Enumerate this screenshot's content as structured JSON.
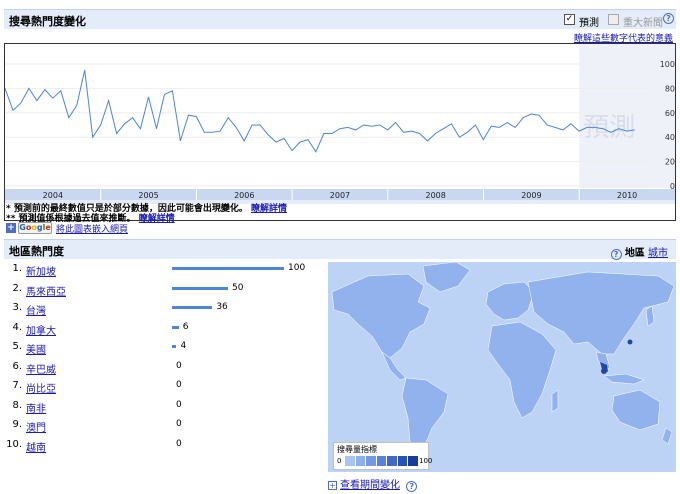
{
  "top_section": {
    "title": "搜尋熱門度變化",
    "forecast_label": "預測",
    "forecast_checked": true,
    "news_label": "重大新聞",
    "news_checked": false,
    "help": "?",
    "learn_link": "瞭解這些數字代表的意義"
  },
  "chart_data": {
    "type": "line",
    "title": "",
    "xlabel": "",
    "ylabel": "",
    "ylim": [
      0,
      100
    ],
    "yticks": [
      "100",
      "80",
      "60",
      "40",
      "20",
      "0"
    ],
    "year_labels": [
      "2004",
      "2005",
      "2006",
      "2007",
      "2008",
      "2009",
      "2010"
    ],
    "x_start": 2004.0,
    "forecast_start": 2010.0,
    "forecast_watermark": "預測",
    "series": [
      {
        "x_step": 0.0833,
        "values": [
          80,
          62,
          68,
          80,
          70,
          79,
          72,
          78,
          56,
          66,
          95,
          40,
          50,
          70,
          43,
          51,
          56,
          47,
          73,
          47,
          75,
          78,
          37,
          58,
          57,
          44,
          44,
          45,
          56,
          48,
          37,
          50,
          50,
          42,
          36,
          39,
          29,
          36,
          38,
          28,
          43,
          43,
          47,
          48,
          46,
          50,
          49,
          50,
          46,
          52,
          44,
          45,
          43,
          37,
          43,
          47,
          51,
          40,
          44,
          50,
          38,
          49,
          48,
          52,
          48,
          56,
          59,
          58,
          50,
          48,
          46,
          51,
          45,
          48,
          48,
          47,
          44,
          47,
          45,
          46
        ]
      }
    ]
  },
  "notes": {
    "note1": "* 預測前的最終數值只是於部分數據，因此可能會出現變化。",
    "note1_link": "瞭解詳情",
    "note2": "** 預測值係根據過去值來推斷。",
    "note2_link": "瞭解詳情"
  },
  "embed": {
    "plus": "+",
    "logo": "Google",
    "link": "將此圖表嵌入網頁"
  },
  "region_section": {
    "title": "地區熱門度",
    "help": "?",
    "region_label": "地區",
    "city_link": "城市"
  },
  "regions": [
    {
      "rank": "1.",
      "name": "新加坡",
      "value": 100,
      "label": "100"
    },
    {
      "rank": "2.",
      "name": "馬來西亞",
      "value": 50,
      "label": "50"
    },
    {
      "rank": "3.",
      "name": "台灣",
      "value": 36,
      "label": "36"
    },
    {
      "rank": "4.",
      "name": "加拿大",
      "value": 6,
      "label": "6"
    },
    {
      "rank": "5.",
      "name": "美國",
      "value": 4,
      "label": "4"
    },
    {
      "rank": "6.",
      "name": "辛巴威",
      "value": 0,
      "label": "0"
    },
    {
      "rank": "7.",
      "name": "尚比亞",
      "value": 0,
      "label": "0"
    },
    {
      "rank": "8.",
      "name": "南非",
      "value": 0,
      "label": "0"
    },
    {
      "rank": "9.",
      "name": "澳門",
      "value": 0,
      "label": "0"
    },
    {
      "rank": "10.",
      "name": "越南",
      "value": 0,
      "label": "0"
    }
  ],
  "map_legend": {
    "title": "搜尋量指標",
    "low": "0",
    "high": "100",
    "colors": [
      "#a8c4f2",
      "#8fb0ec",
      "#7399e4",
      "#5a82da",
      "#4169c9",
      "#2a52b3",
      "#173d98"
    ]
  },
  "change_link": {
    "plus": "+",
    "label": "查看期間變化",
    "help": "?"
  },
  "colors": {
    "header_bg": "#e5ecf9",
    "line": "#4b85d6",
    "bar": "#4b85d6",
    "land": "#91b2ec",
    "ocean": "#bdd3f6"
  }
}
